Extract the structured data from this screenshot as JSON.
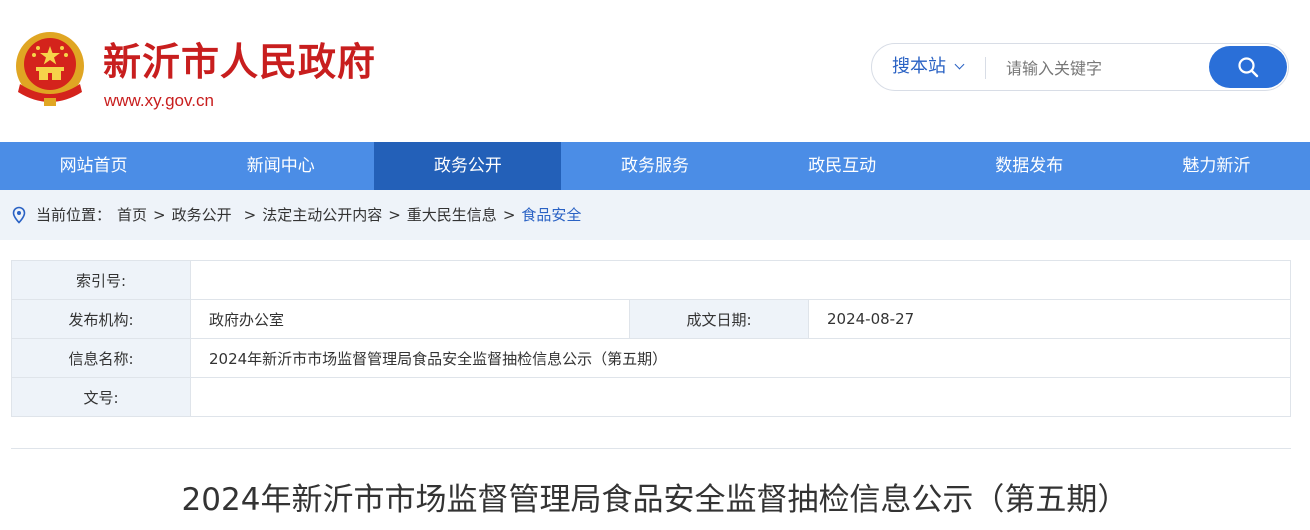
{
  "header": {
    "site_name": "新沂市人民政府",
    "site_url": "www.xy.gov.cn",
    "brand_color": "#c81e1e"
  },
  "search": {
    "scope_label": "搜本站",
    "placeholder": "请输入关键字",
    "button_icon": "search-icon"
  },
  "nav": {
    "items": [
      {
        "label": "网站首页"
      },
      {
        "label": "新闻中心"
      },
      {
        "label": "政务公开",
        "active": true
      },
      {
        "label": "政务服务"
      },
      {
        "label": "政民互动"
      },
      {
        "label": "数据发布"
      },
      {
        "label": "魅力新沂"
      }
    ],
    "bg_color": "#4b8de6",
    "active_color": "#2360b8"
  },
  "breadcrumb": {
    "prefix": "当前位置：",
    "items": [
      "首页",
      "政务公开",
      "法定主动公开内容",
      "重大民生信息",
      "食品安全"
    ]
  },
  "meta": {
    "index_label": "索引号:",
    "index_value": "",
    "publisher_label": "发布机构:",
    "publisher_value": "政府办公室",
    "date_label": "成文日期:",
    "date_value": "2024-08-27",
    "title_label": "信息名称:",
    "title_value": "2024年新沂市市场监督管理局食品安全监督抽检信息公示（第五期）",
    "doc_no_label": "文号:",
    "doc_no_value": ""
  },
  "article": {
    "title": "2024年新沂市市场监督管理局食品安全监督抽检信息公示（第五期）"
  }
}
